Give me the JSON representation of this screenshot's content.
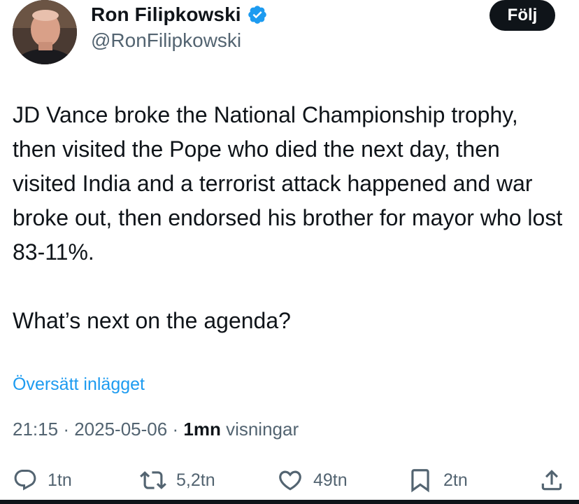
{
  "author": {
    "display_name": "Ron Filipkowski",
    "handle": "@RonFilipkowski",
    "verified": true
  },
  "follow_button": {
    "label": "Följ"
  },
  "tweet": {
    "paragraphs": [
      "JD Vance broke the National Championship trophy, then visited the Pope who died the next day, then visited India and a terrorist attack happened and war broke out, then endorsed his brother for mayor who lost 83-11%.",
      "What’s next on the agenda?"
    ],
    "translate_link": "Översätt inlägget"
  },
  "meta": {
    "time": "21:15",
    "date": "2025-05-06",
    "separator": "·",
    "views_count": "1mn",
    "views_label": "visningar"
  },
  "actions": {
    "reply": {
      "icon": "reply-icon",
      "count": "1tn"
    },
    "retweet": {
      "icon": "retweet-icon",
      "count": "5,2tn"
    },
    "like": {
      "icon": "heart-icon",
      "count": "49tn"
    },
    "bookmark": {
      "icon": "bookmark-icon",
      "count": "2tn"
    },
    "share": {
      "icon": "share-icon"
    }
  },
  "colors": {
    "text": "#0f1419",
    "secondary": "#536471",
    "link": "#1d9bf0",
    "verified_badge": "#1d9bf0",
    "follow_button_bg": "#0f1419"
  }
}
